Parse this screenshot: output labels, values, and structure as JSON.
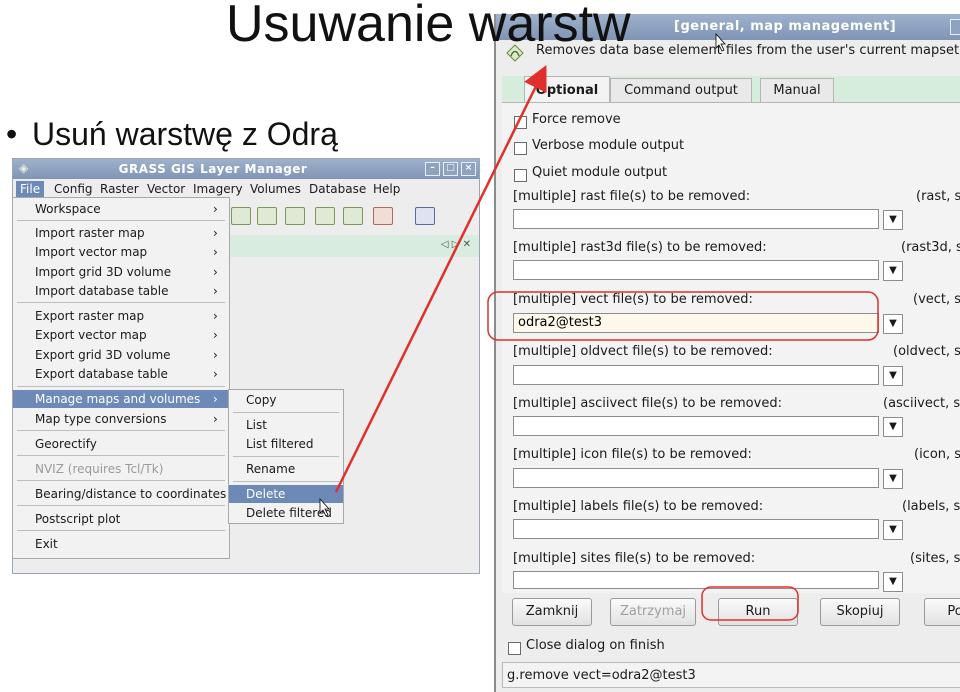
{
  "slide": {
    "title": "Usuwanie warstw",
    "bullet": "Usuń warstwę z Odrą"
  },
  "layer_manager": {
    "title": "GRASS GIS Layer Manager",
    "menubar": [
      "File",
      "Config",
      "Raster",
      "Vector",
      "Imagery",
      "Volumes",
      "Database",
      "Help"
    ],
    "tab_nav": "◁ ▷ ✕",
    "file_menu": [
      {
        "label": "Workspace",
        "submenu": true
      },
      {
        "label": "Import raster map",
        "submenu": true
      },
      {
        "label": "Import vector map",
        "submenu": true
      },
      {
        "label": "Import grid 3D volume",
        "submenu": true
      },
      {
        "label": "Import database table",
        "submenu": true
      },
      {
        "label": "Export raster map",
        "submenu": true
      },
      {
        "label": "Export vector map",
        "submenu": true
      },
      {
        "label": "Export grid 3D volume",
        "submenu": true
      },
      {
        "label": "Export database table",
        "submenu": true
      },
      {
        "label": "Manage maps and volumes",
        "submenu": true
      },
      {
        "label": "Map type conversions",
        "submenu": true
      },
      {
        "label": "Georectify",
        "submenu": false
      },
      {
        "label": "NVIZ (requires Tcl/Tk)",
        "submenu": false
      },
      {
        "label": "Bearing/distance to coordinates",
        "submenu": false
      },
      {
        "label": "Postscript plot",
        "submenu": false
      },
      {
        "label": "Exit",
        "submenu": false
      }
    ],
    "submenu": [
      "Copy",
      "List",
      "List filtered",
      "Rename",
      "Delete",
      "Delete filtered"
    ]
  },
  "dialog": {
    "title": "[general, map management]",
    "description": "Removes data base element files from the user's current mapset.",
    "tabs": [
      "Optional",
      "Command output",
      "Manual"
    ],
    "checkboxes": [
      "Force remove",
      "Verbose module output",
      "Quiet module output"
    ],
    "fields": [
      {
        "label": "[multiple] rast file(s) to be removed:",
        "key": "(rast, s",
        "value": ""
      },
      {
        "label": "[multiple] rast3d file(s) to be removed:",
        "key": "(rast3d, s",
        "value": ""
      },
      {
        "label": "[multiple] vect file(s) to be removed:",
        "key": "(vect, s",
        "value": "odra2@test3"
      },
      {
        "label": "[multiple] oldvect file(s) to be removed:",
        "key": "(oldvect, s",
        "value": ""
      },
      {
        "label": "[multiple] asciivect file(s) to be removed:",
        "key": "(asciivect, s",
        "value": ""
      },
      {
        "label": "[multiple] icon file(s) to be removed:",
        "key": "(icon, s",
        "value": ""
      },
      {
        "label": "[multiple] labels file(s) to be removed:",
        "key": "(labels, s",
        "value": ""
      },
      {
        "label": "[multiple] sites file(s) to be removed:",
        "key": "(sites, s",
        "value": ""
      }
    ],
    "buttons": [
      "Zamknij",
      "Zatrzymaj",
      "Run",
      "Skopiuj",
      "Po"
    ],
    "close_on_finish": "Close dialog on finish",
    "status_command": "g.remove vect=odra2@test3"
  },
  "colors": {
    "highlight_ring": "#e0302c",
    "menu_selection": "#6c89b7",
    "titlebar": "#8ea3c1"
  }
}
